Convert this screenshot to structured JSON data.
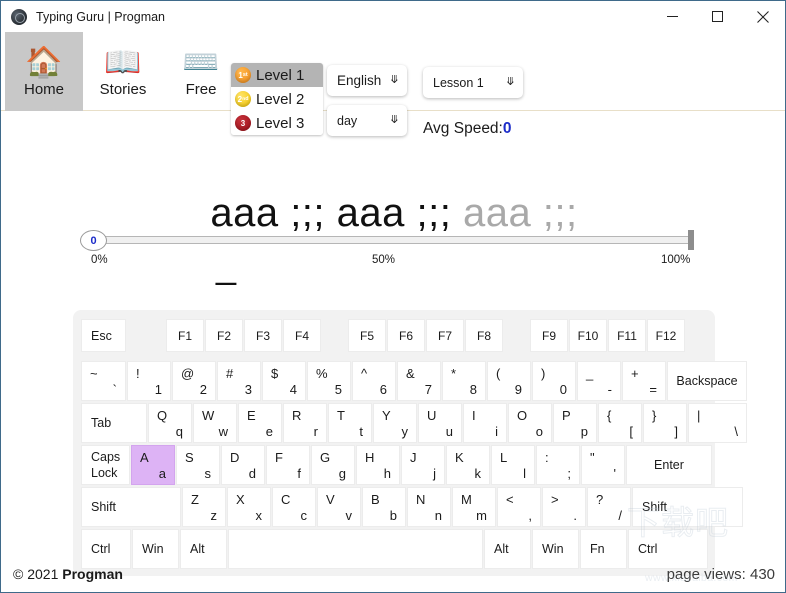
{
  "window": {
    "title": "Typing Guru | Progman",
    "app_icon": "app-circle-icon",
    "controls": {
      "minimize": "minimize-icon",
      "maximize": "maximize-icon",
      "close": "close-icon"
    }
  },
  "toolbar": {
    "nav": [
      {
        "label": "Home",
        "icon": "house-icon",
        "emoji": "🏠",
        "selected": true
      },
      {
        "label": "Stories",
        "icon": "open-book-icon",
        "emoji": "📖",
        "selected": false
      },
      {
        "label": "Free",
        "icon": "keyboard-icon",
        "emoji": "⌨️",
        "selected": false
      }
    ],
    "levels": [
      {
        "label": "Level 1",
        "badge": "1ˢᵗ",
        "medal": "gold-medal-icon",
        "active": true
      },
      {
        "label": "Level 2",
        "badge": "2ⁿᵈ",
        "medal": "silver-medal-icon",
        "active": false
      },
      {
        "label": "Level 3",
        "badge": "3",
        "medal": "bronze-medal-icon",
        "active": false
      }
    ],
    "language_select": {
      "value": "English",
      "caret": "chevron-down-icon"
    },
    "period_select": {
      "value": "day",
      "caret": "chevron-down-icon"
    },
    "lesson_select": {
      "value": "Lesson 1",
      "caret": "chevron-down-icon"
    },
    "avg_speed_label": "Avg Speed:",
    "avg_speed_value": "0"
  },
  "progress": {
    "thumb_value": "0",
    "ticks": {
      "start": "0%",
      "middle": "50%",
      "end": "100%"
    },
    "percent": 0
  },
  "lesson": {
    "typed_text": "aaa ;;; aaa ;;; ",
    "pending_text": "aaa ;;;",
    "cursor": "_"
  },
  "keyboard": {
    "highlight_key": "A",
    "rows": {
      "function": [
        "Esc",
        "F1",
        "F2",
        "F3",
        "F4",
        "F5",
        "F6",
        "F7",
        "F8",
        "F9",
        "F10",
        "F11",
        "F12"
      ],
      "numbers": [
        {
          "up": "~",
          "lo": "`"
        },
        {
          "up": "!",
          "lo": "1"
        },
        {
          "up": "@",
          "lo": "2"
        },
        {
          "up": "#",
          "lo": "3"
        },
        {
          "up": "$",
          "lo": "4"
        },
        {
          "up": "%",
          "lo": "5"
        },
        {
          "up": "^",
          "lo": "6"
        },
        {
          "up": "&",
          "lo": "7"
        },
        {
          "up": "*",
          "lo": "8"
        },
        {
          "up": "(",
          "lo": "9"
        },
        {
          "up": ")",
          "lo": "0"
        },
        {
          "up": "_",
          "lo": "-"
        },
        {
          "up": "+",
          "lo": "="
        }
      ],
      "backspace": "Backspace",
      "tab": "Tab",
      "qwerty": [
        {
          "up": "Q",
          "lo": "q"
        },
        {
          "up": "W",
          "lo": "w"
        },
        {
          "up": "E",
          "lo": "e"
        },
        {
          "up": "R",
          "lo": "r"
        },
        {
          "up": "T",
          "lo": "t"
        },
        {
          "up": "Y",
          "lo": "y"
        },
        {
          "up": "U",
          "lo": "u"
        },
        {
          "up": "I",
          "lo": "i"
        },
        {
          "up": "O",
          "lo": "o"
        },
        {
          "up": "P",
          "lo": "p"
        },
        {
          "up": "{",
          "lo": "["
        },
        {
          "up": "}",
          "lo": "]"
        },
        {
          "up": "|",
          "lo": "\\"
        }
      ],
      "capslock_line1": "Caps",
      "capslock_line2": "Lock",
      "home": [
        {
          "up": "A",
          "lo": "a"
        },
        {
          "up": "S",
          "lo": "s"
        },
        {
          "up": "D",
          "lo": "d"
        },
        {
          "up": "F",
          "lo": "f"
        },
        {
          "up": "G",
          "lo": "g"
        },
        {
          "up": "H",
          "lo": "h"
        },
        {
          "up": "J",
          "lo": "j"
        },
        {
          "up": "K",
          "lo": "k"
        },
        {
          "up": "L",
          "lo": "l"
        },
        {
          "up": ":",
          "lo": ";"
        },
        {
          "up": "\"",
          "lo": "'"
        }
      ],
      "enter": "Enter",
      "shift_left": "Shift",
      "bottom_letters": [
        {
          "up": "Z",
          "lo": "z"
        },
        {
          "up": "X",
          "lo": "x"
        },
        {
          "up": "C",
          "lo": "c"
        },
        {
          "up": "V",
          "lo": "v"
        },
        {
          "up": "B",
          "lo": "b"
        },
        {
          "up": "N",
          "lo": "n"
        },
        {
          "up": "M",
          "lo": "m"
        },
        {
          "up": "<",
          "lo": ","
        },
        {
          "up": ">",
          "lo": "."
        },
        {
          "up": "?",
          "lo": "/"
        }
      ],
      "shift_right": "Shift",
      "modifiers": [
        "Ctrl",
        "Win",
        "Alt",
        "",
        "Alt",
        "Win",
        "Fn",
        "Ctrl"
      ]
    }
  },
  "footer": {
    "copyright_prefix": "© 2021 ",
    "copyright_brand": "Progman",
    "page_views": "page views: 430"
  },
  "watermark": {
    "text_cn": "下载吧",
    "url": "www.xiazaiba.com"
  }
}
